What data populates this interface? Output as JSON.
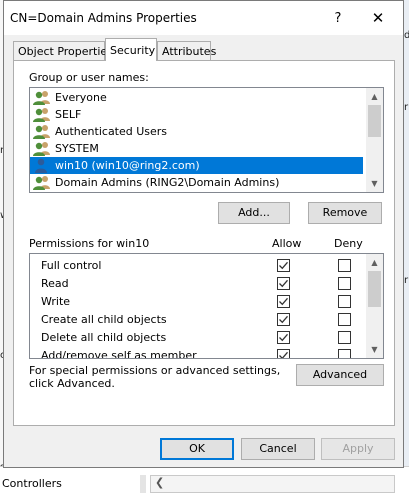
{
  "background": {
    "fragments": [
      "d",
      "r",
      "rs",
      "w",
      "r",
      "c",
      "s",
      "Controllers"
    ]
  },
  "dialog": {
    "title": "CN=Domain Admins Properties",
    "help_label": "?",
    "close_label": "✕"
  },
  "tabs": [
    {
      "label": "Object Properties",
      "selected": false
    },
    {
      "label": "Security",
      "selected": true
    },
    {
      "label": "Attributes",
      "selected": false
    }
  ],
  "security": {
    "group_label": "Group or user names:",
    "users": [
      {
        "name": "Everyone",
        "selected": false
      },
      {
        "name": "SELF",
        "selected": false
      },
      {
        "name": "Authenticated Users",
        "selected": false
      },
      {
        "name": "SYSTEM",
        "selected": false
      },
      {
        "name": "win10 (win10@ring2.com)",
        "selected": true
      },
      {
        "name": "Domain Admins (RING2\\Domain Admins)",
        "selected": false
      }
    ],
    "add_label": "Add...",
    "remove_label": "Remove",
    "permissions_for_label": "Permissions for win10",
    "allow_header": "Allow",
    "deny_header": "Deny",
    "permissions": [
      {
        "name": "Full control",
        "allow": true,
        "deny": false
      },
      {
        "name": "Read",
        "allow": true,
        "deny": false
      },
      {
        "name": "Write",
        "allow": true,
        "deny": false
      },
      {
        "name": "Create all child objects",
        "allow": true,
        "deny": false
      },
      {
        "name": "Delete all child objects",
        "allow": true,
        "deny": false
      },
      {
        "name": "Add/remove self as member",
        "allow": true,
        "deny": false
      }
    ],
    "advanced_text": "For special permissions or advanced settings, click Advanced.",
    "advanced_label": "Advanced"
  },
  "footer": {
    "ok_label": "OK",
    "cancel_label": "Cancel",
    "apply_label": "Apply"
  },
  "colors": {
    "selection": "#0078d7",
    "user_icon_green": "#4f8f3a",
    "user_icon_tan": "#c8a26a",
    "user_icon_blue": "#2c5b9a"
  }
}
